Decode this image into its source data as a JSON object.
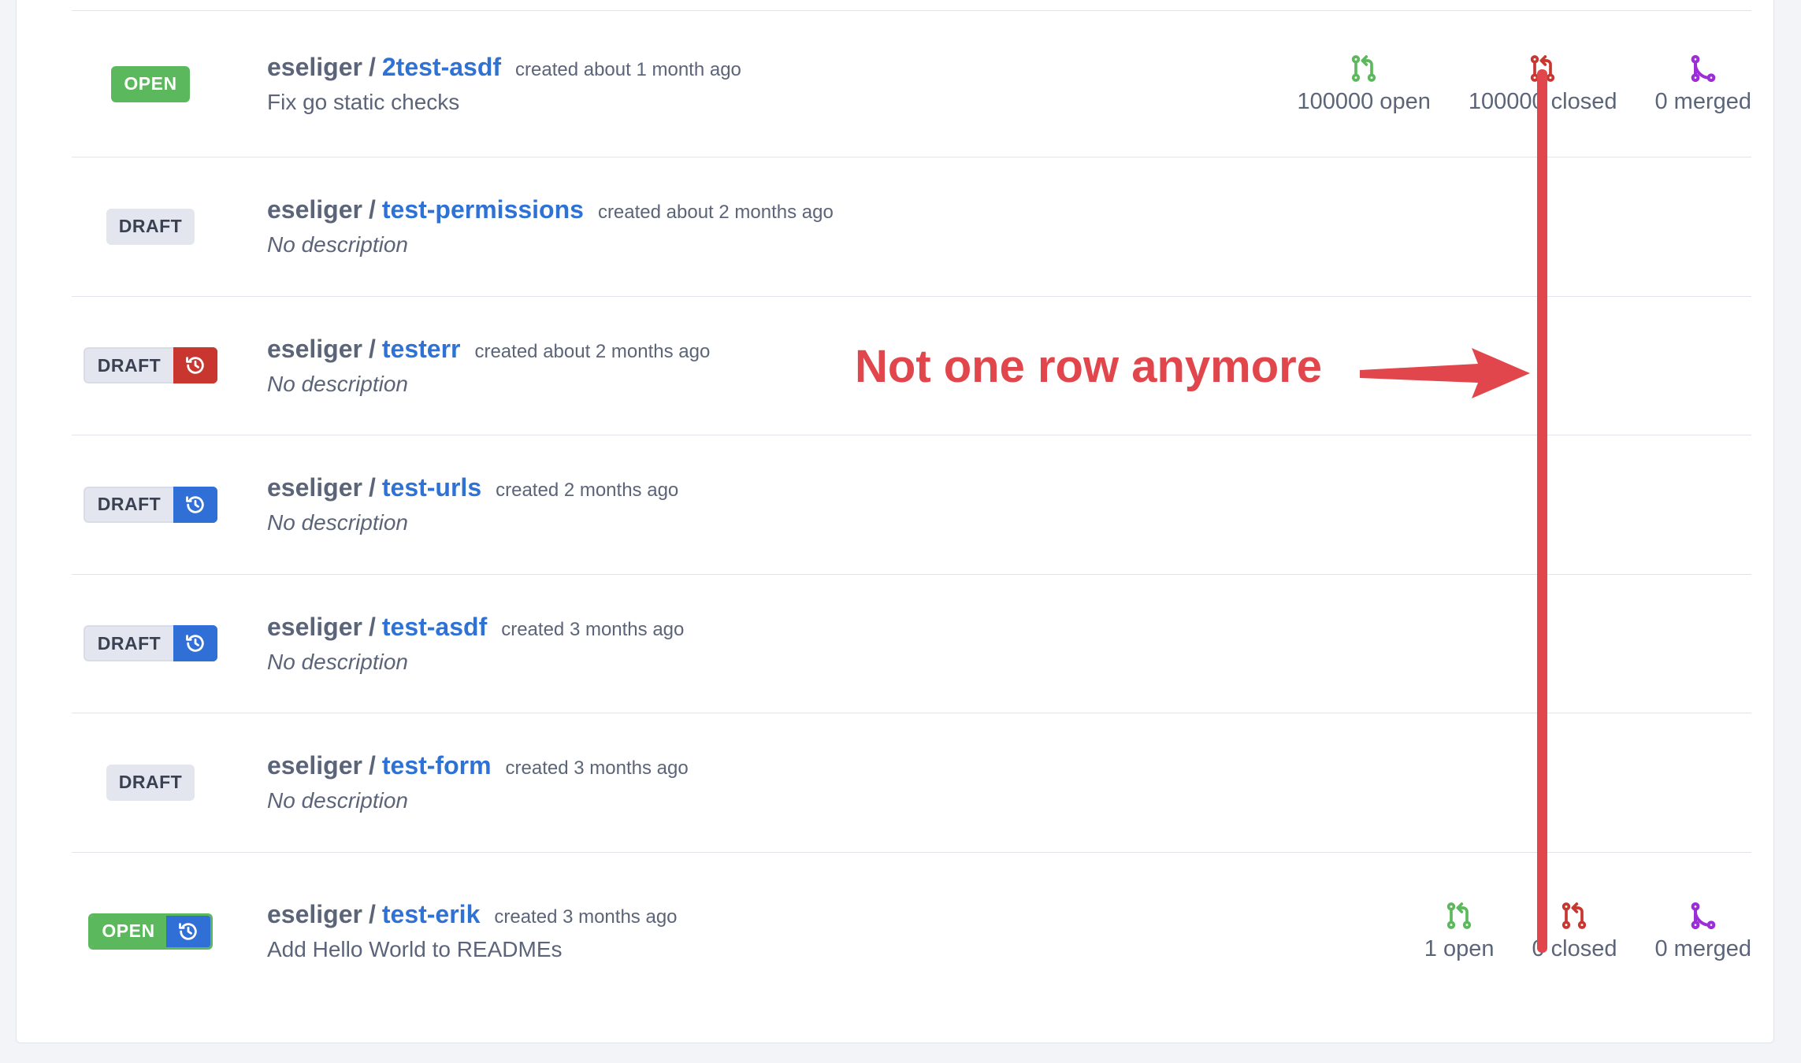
{
  "colors": {
    "open": "#5cb85c",
    "draft": "#e3e6ee",
    "link": "#2f72d6",
    "open_icon": "#5cb85c",
    "closed_icon": "#c8362f",
    "merged_icon": "#9b2ed6",
    "annotation": "#e0464b"
  },
  "rows": [
    {
      "status": "OPEN",
      "owner": "eseliger",
      "sep": "/",
      "repo": "2test-asdf",
      "created": "created about 1 month ago",
      "description": "Fix go static checks",
      "stats": {
        "open": "100000 open",
        "closed": "100000 closed",
        "merged": "0 merged"
      }
    },
    {
      "status": "DRAFT",
      "owner": "eseliger",
      "sep": "/",
      "repo": "test-permissions",
      "created": "created about 2 months ago",
      "description": "No description"
    },
    {
      "status": "DRAFT",
      "owner": "eseliger",
      "sep": "/",
      "repo": "testerr",
      "created": "created about 2 months ago",
      "description": "No description"
    },
    {
      "status": "DRAFT",
      "owner": "eseliger",
      "sep": "/",
      "repo": "test-urls",
      "created": "created 2 months ago",
      "description": "No description"
    },
    {
      "status": "DRAFT",
      "owner": "eseliger",
      "sep": "/",
      "repo": "test-asdf",
      "created": "created 3 months ago",
      "description": "No description"
    },
    {
      "status": "DRAFT",
      "owner": "eseliger",
      "sep": "/",
      "repo": "test-form",
      "created": "created 3 months ago",
      "description": "No description"
    },
    {
      "status": "OPEN",
      "owner": "eseliger",
      "sep": "/",
      "repo": "test-erik",
      "created": "created 3 months ago",
      "description": "Add Hello World to READMEs",
      "stats": {
        "open": "1 open",
        "closed": "0 closed",
        "merged": "0 merged"
      }
    }
  ],
  "annotation": {
    "text": "Not one row anymore"
  }
}
